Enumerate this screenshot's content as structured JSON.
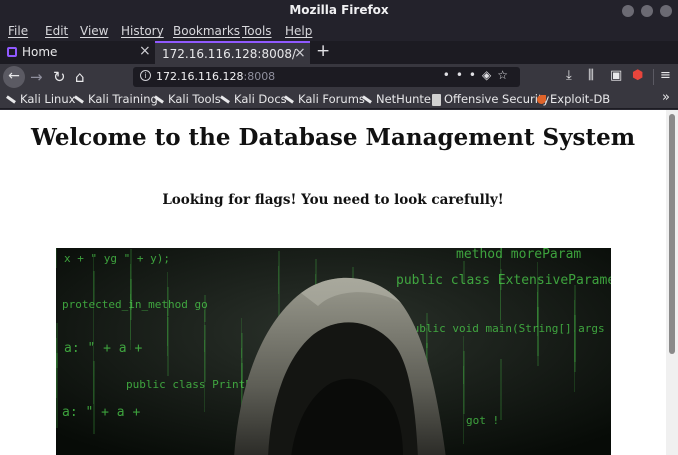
{
  "window": {
    "title": "Mozilla Firefox"
  },
  "menu": {
    "items": [
      "File",
      "Edit",
      "View",
      "History",
      "Bookmarks",
      "Tools",
      "Help"
    ]
  },
  "tabs": [
    {
      "label": "Home"
    },
    {
      "label": "172.16.116.128:8008/"
    }
  ],
  "url": {
    "host": "172.16.116.128",
    "port": ":8008"
  },
  "bookmarks": [
    {
      "label": "Kali Linux"
    },
    {
      "label": "Kali Training"
    },
    {
      "label": "Kali Tools"
    },
    {
      "label": "Kali Docs"
    },
    {
      "label": "Kali Forums"
    },
    {
      "label": "NetHunter"
    },
    {
      "label": "Offensive Security"
    },
    {
      "label": "Exploit-DB"
    }
  ],
  "page": {
    "heading": "Welcome to the Database Management System",
    "subheading": "Looking for flags! You need to look carefully!",
    "hero_code_lines": [
      "x + \" yg \" + y);",
      "method moreParam",
      "protected_in_method go",
      "public class ExtensiveParameters",
      "public void main(String[] args",
      "a: \" + a +",
      "public class PrintParameter",
      "a: \" + a +",
      "got !"
    ]
  },
  "colors": {
    "accent": "#9059ff",
    "code_green": "#4cd14c"
  }
}
